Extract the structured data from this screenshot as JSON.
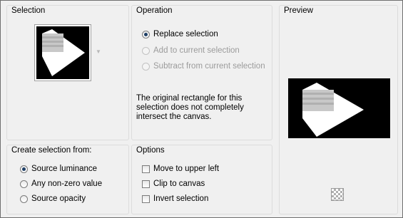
{
  "selection": {
    "title": "Selection"
  },
  "operation": {
    "title": "Operation",
    "options": [
      {
        "label": "Replace selection",
        "selected": true,
        "enabled": true
      },
      {
        "label": "Add to current selection",
        "selected": false,
        "enabled": false
      },
      {
        "label": "Subtract from current selection",
        "selected": false,
        "enabled": false
      }
    ],
    "note": "The original rectangle for this selection does not completely intersect the canvas."
  },
  "preview": {
    "title": "Preview",
    "toggle_icon": "checkerboard-icon"
  },
  "create_from": {
    "title": "Create selection from:",
    "options": [
      {
        "label": "Source luminance",
        "selected": true
      },
      {
        "label": "Any non-zero value",
        "selected": false
      },
      {
        "label": "Source opacity",
        "selected": false
      }
    ]
  },
  "options_group": {
    "title": "Options",
    "checkboxes": [
      {
        "label": "Move to upper left",
        "checked": false
      },
      {
        "label": "Clip to canvas",
        "checked": false
      },
      {
        "label": "Invert selection",
        "checked": false
      }
    ]
  }
}
